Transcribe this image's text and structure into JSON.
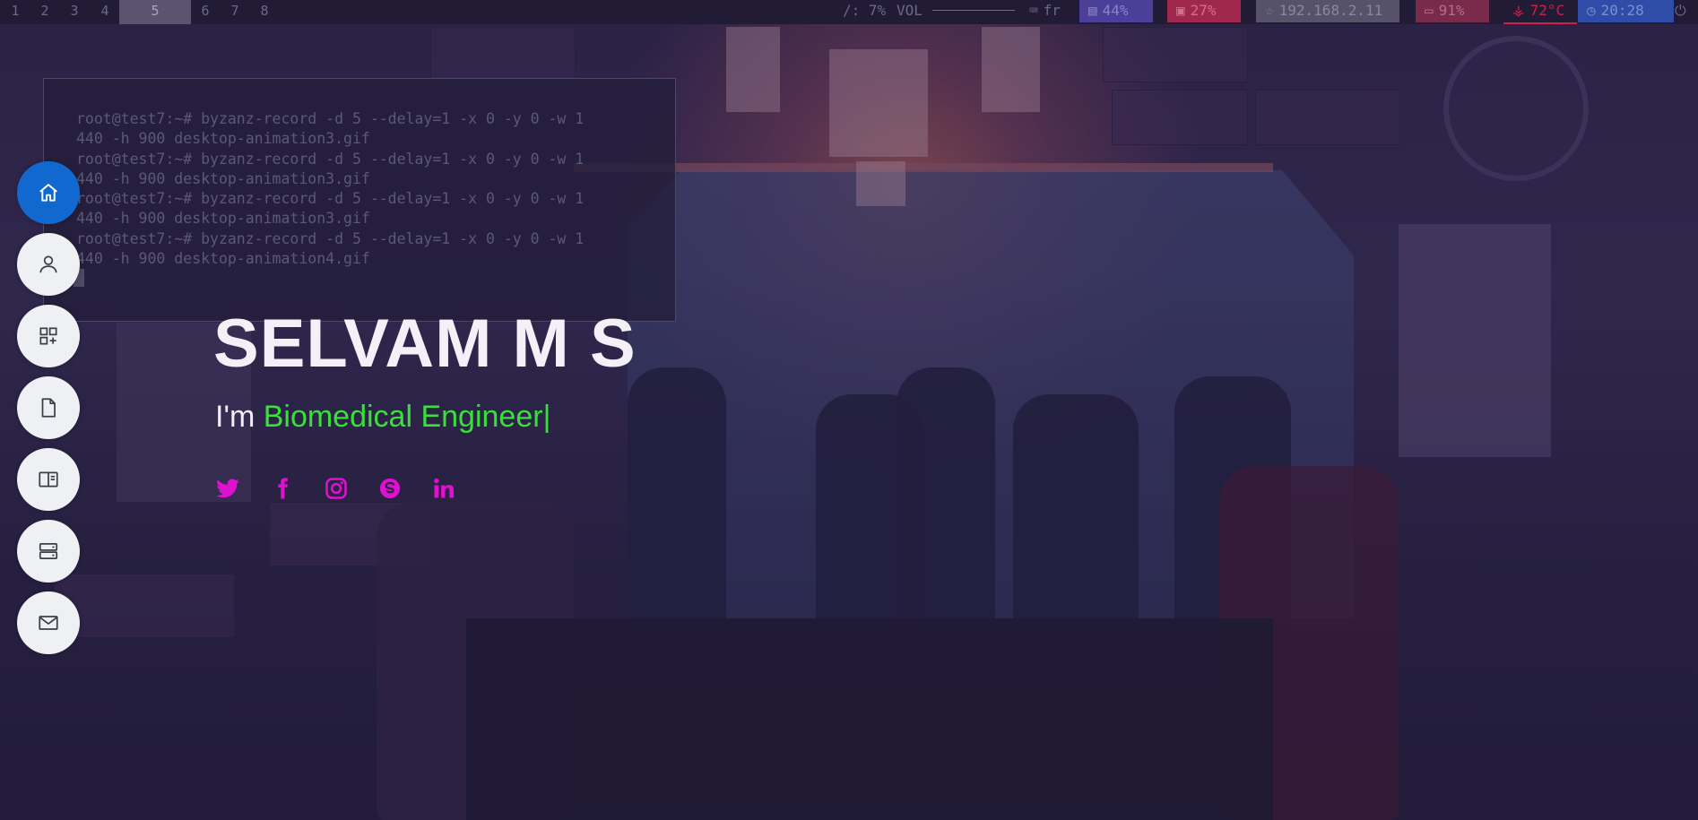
{
  "topbar": {
    "workspaces": [
      {
        "label": "1",
        "active": false
      },
      {
        "label": "2",
        "active": false
      },
      {
        "label": "3",
        "active": false
      },
      {
        "label": "4",
        "active": false
      },
      {
        "label": "5",
        "active": true
      },
      {
        "label": "6",
        "active": false
      },
      {
        "label": "7",
        "active": false
      },
      {
        "label": "8",
        "active": false
      }
    ],
    "disk": "/: 7%",
    "volume_label": "VOL",
    "keyboard_layout": "fr",
    "memory": "44%",
    "cpu": "27%",
    "ip_address": "192.168.2.11",
    "battery": "91%",
    "temperature": "72°C",
    "clock": "20:28",
    "colors": {
      "memory_bg": "#4b3f9a",
      "cpu_bg": "#a0284e",
      "network_bg": "#55526a",
      "battery_bg": "#7a2a4a",
      "temperature_fg": "#d0204a",
      "clock_bg": "#2f4da8"
    }
  },
  "terminal": {
    "lines": [
      "root@test7:~# byzanz-record -d 5 --delay=1 -x 0 -y 0 -w 1",
      "440 -h 900 desktop-animation3.gif",
      "root@test7:~# byzanz-record -d 5 --delay=1 -x 0 -y 0 -w 1",
      "440 -h 900 desktop-animation3.gif",
      "root@test7:~# byzanz-record -d 5 --delay=1 -x 0 -y 0 -w 1",
      "440 -h 900 desktop-animation3.gif",
      "root@test7:~# byzanz-record -d 5 --delay=1 -x 0 -y 0 -w 1",
      "440 -h 900 desktop-animation4.gif"
    ]
  },
  "hero": {
    "name": "SELVAM M S",
    "prefix": "I'm ",
    "role": "Biomedical Engineer",
    "caret": "|"
  },
  "social_links": [
    {
      "name": "twitter-icon",
      "color": "#e010d0"
    },
    {
      "name": "facebook-icon",
      "color": "#e010d0"
    },
    {
      "name": "instagram-icon",
      "color": "#e010d0"
    },
    {
      "name": "skype-icon",
      "color": "#e010d0"
    },
    {
      "name": "linkedin-icon",
      "color": "#e010d0"
    }
  ],
  "side_nav": [
    {
      "name": "home-icon",
      "active": true
    },
    {
      "name": "user-icon",
      "active": false
    },
    {
      "name": "apps-add-icon",
      "active": false
    },
    {
      "name": "document-icon",
      "active": false
    },
    {
      "name": "book-icon",
      "active": false
    },
    {
      "name": "server-icon",
      "active": false
    },
    {
      "name": "mail-icon",
      "active": false
    }
  ],
  "colors": {
    "accent": "#1169cf",
    "role_text": "#3ae03a",
    "social": "#e010d0"
  }
}
